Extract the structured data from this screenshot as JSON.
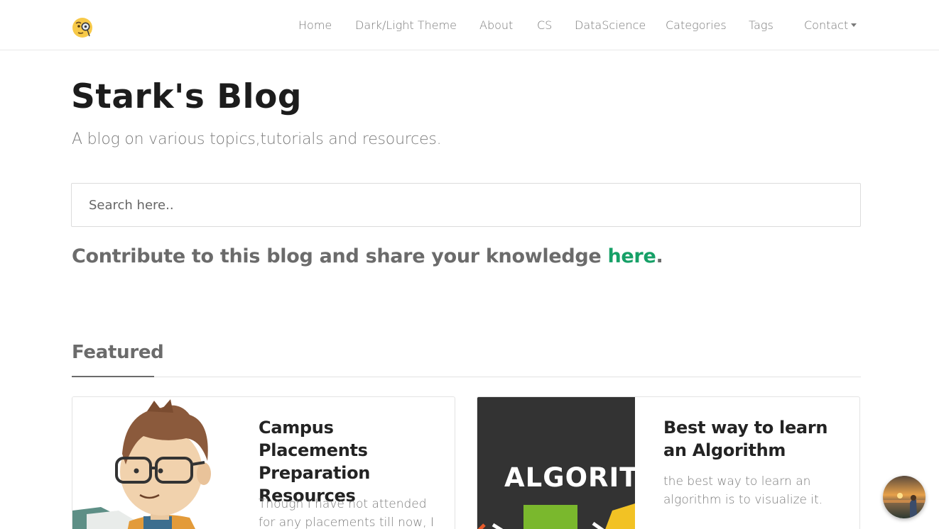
{
  "nav": {
    "logo_icon": "monocle-face-icon",
    "items": [
      {
        "label": "Home"
      },
      {
        "label": "Dark/Light Theme"
      },
      {
        "label": "About"
      },
      {
        "label": "CS"
      },
      {
        "label": "DataScience"
      },
      {
        "label": "Categories"
      },
      {
        "label": "Tags"
      },
      {
        "label": "Contact"
      }
    ]
  },
  "hero": {
    "title": "Stark's Blog",
    "subtitle": "A blog on various topics,tutorials and resources."
  },
  "search": {
    "placeholder": "Search here.."
  },
  "contribute": {
    "text": "Contribute to this blog and share your knowledge ",
    "link": "here",
    "suffix": "."
  },
  "featured": {
    "heading": "Featured",
    "cards": [
      {
        "title": "Campus Placements Preparation Resources",
        "excerpt": "Though I have not attended for any placements till now, I",
        "image_icon": "cartoon-student-illustration"
      },
      {
        "title": "Best way to learn an Algorithm",
        "excerpt": "the best way to learn an algorithm is to visualize it.",
        "image_text": "ALGORIT"
      }
    ]
  },
  "chat": {
    "avatar_icon": "chat-avatar-icon"
  },
  "colors": {
    "accent": "#16a067",
    "heading": "#1c1c1c",
    "muted": "#7a7a7a"
  }
}
